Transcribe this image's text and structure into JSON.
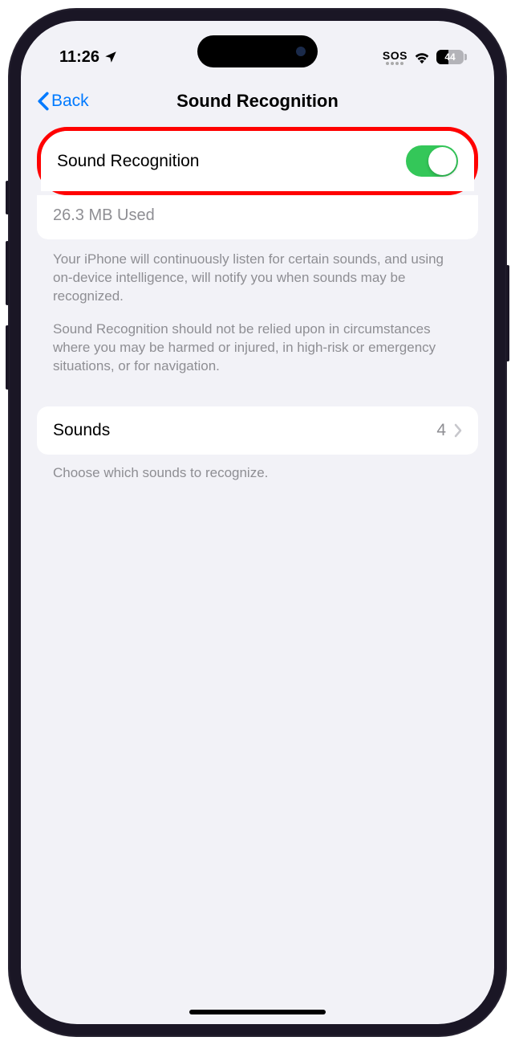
{
  "status": {
    "time": "11:26",
    "sos": "SOS",
    "battery_level": "44"
  },
  "nav": {
    "back": "Back",
    "title": "Sound Recognition"
  },
  "main_toggle": {
    "label": "Sound Recognition",
    "storage": "26.3 MB Used"
  },
  "description": {
    "p1": "Your iPhone will continuously listen for certain sounds, and using on-device intelligence, will notify you when sounds may be recognized.",
    "p2": "Sound Recognition should not be relied upon in circumstances where you may be harmed or injured, in high-risk or emergency situations, or for navigation."
  },
  "sounds_row": {
    "label": "Sounds",
    "count": "4"
  },
  "sounds_footer": "Choose which sounds to recognize."
}
